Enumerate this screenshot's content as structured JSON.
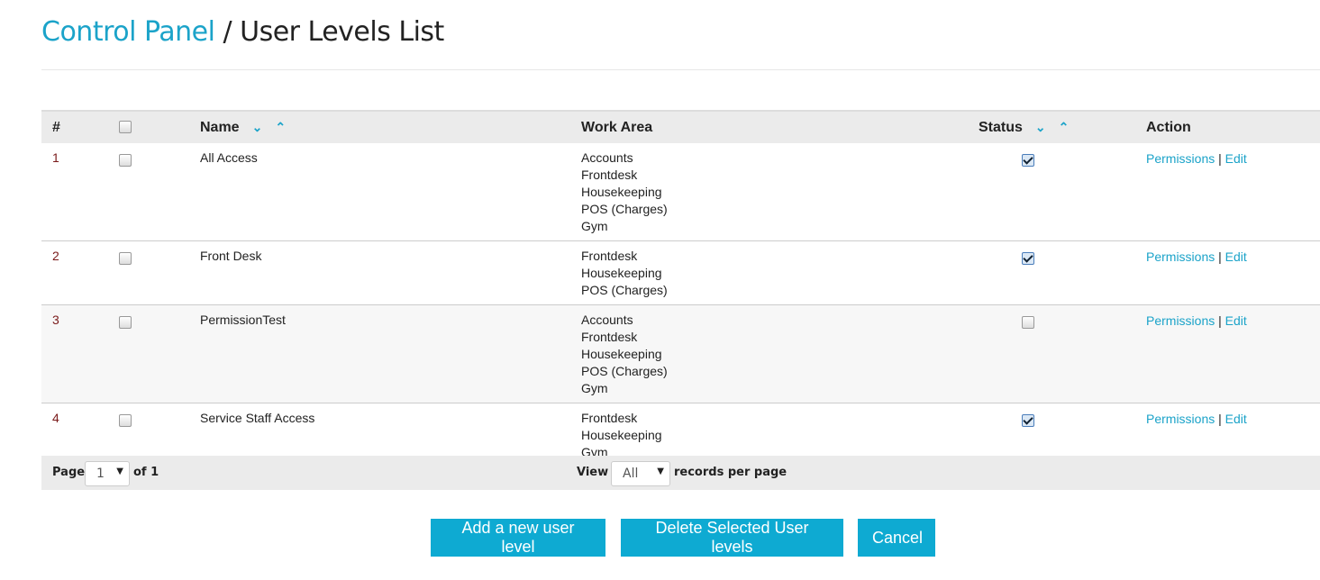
{
  "header": {
    "breadcrumb_link": "Control Panel",
    "separator": " / ",
    "title": "User Levels List"
  },
  "table": {
    "columns": {
      "num": "#",
      "name": "Name",
      "work_area": "Work Area",
      "status": "Status",
      "action": "Action"
    },
    "rows": [
      {
        "num": "1",
        "name": "All Access",
        "work_areas": [
          "Accounts",
          "Frontdesk",
          "Housekeeping",
          "POS (Charges)",
          "Gym"
        ],
        "status": true
      },
      {
        "num": "2",
        "name": "Front Desk",
        "work_areas": [
          "Frontdesk",
          "Housekeeping",
          "POS (Charges)"
        ],
        "status": true
      },
      {
        "num": "3",
        "name": "PermissionTest",
        "work_areas": [
          "Accounts",
          "Frontdesk",
          "Housekeeping",
          "POS (Charges)",
          "Gym"
        ],
        "status": false
      },
      {
        "num": "4",
        "name": "Service Staff Access",
        "work_areas": [
          "Frontdesk",
          "Housekeeping",
          "Gym"
        ],
        "status": true
      }
    ],
    "actions": {
      "permissions": "Permissions",
      "sep": "|",
      "edit": "Edit"
    }
  },
  "footer": {
    "page_label": "Page",
    "page_value": "1",
    "of_label": "of 1",
    "view_label": "View",
    "view_value": "All",
    "records_label": "records per page"
  },
  "buttons": {
    "add": "Add a new user level",
    "delete": "Delete Selected User levels",
    "cancel": "Cancel"
  },
  "colors": {
    "accent": "#1ba3c9",
    "button": "#0eaad2"
  }
}
